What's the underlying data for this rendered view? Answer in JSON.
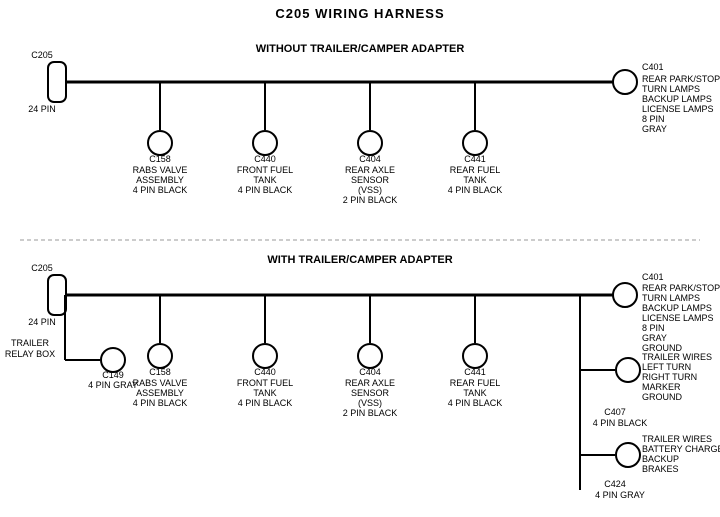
{
  "title": "C205 WIRING HARNESS",
  "section1": {
    "label": "WITHOUT TRAILER/CAMPER ADAPTER",
    "left_connector": {
      "name": "C205",
      "pins": "24 PIN"
    },
    "right_connector": {
      "name": "C401",
      "pins": "8 PIN",
      "color": "GRAY",
      "functions": [
        "REAR PARK/STOP",
        "TURN LAMPS",
        "BACKUP LAMPS",
        "LICENSE LAMPS"
      ]
    },
    "connectors": [
      {
        "name": "C158",
        "desc": "RABS VALVE",
        "desc2": "ASSEMBLY",
        "pins": "4 PIN BLACK"
      },
      {
        "name": "C440",
        "desc": "FRONT FUEL",
        "desc2": "TANK",
        "pins": "4 PIN BLACK"
      },
      {
        "name": "C404",
        "desc": "REAR AXLE",
        "desc2": "SENSOR",
        "desc3": "(VSS)",
        "pins": "2 PIN BLACK"
      },
      {
        "name": "C441",
        "desc": "REAR FUEL",
        "desc2": "TANK",
        "pins": "4 PIN BLACK"
      }
    ]
  },
  "section2": {
    "label": "WITH TRAILER/CAMPER ADAPTER",
    "left_connector": {
      "name": "C205",
      "pins": "24 PIN"
    },
    "right_connector": {
      "name": "C401",
      "pins": "8 PIN",
      "color": "GRAY",
      "functions": [
        "REAR PARK/STOP",
        "TURN LAMPS",
        "BACKUP LAMPS",
        "LICENSE LAMPS",
        "GROUND"
      ]
    },
    "trailer_relay": {
      "label": "TRAILER RELAY BOX"
    },
    "c149": {
      "name": "C149",
      "pins": "4 PIN GRAY"
    },
    "connectors": [
      {
        "name": "C158",
        "desc": "RABS VALVE",
        "desc2": "ASSEMBLY",
        "pins": "4 PIN BLACK"
      },
      {
        "name": "C440",
        "desc": "FRONT FUEL",
        "desc2": "TANK",
        "pins": "4 PIN BLACK"
      },
      {
        "name": "C404",
        "desc": "REAR AXLE",
        "desc2": "SENSOR",
        "desc3": "(VSS)",
        "pins": "2 PIN BLACK"
      },
      {
        "name": "C441",
        "desc": "REAR FUEL",
        "desc2": "TANK",
        "pins": "4 PIN BLACK"
      }
    ],
    "c407": {
      "name": "C407",
      "pins": "4 PIN BLACK",
      "functions": [
        "TRAILER WIRES",
        "LEFT TURN",
        "RIGHT TURN",
        "MARKER",
        "GROUND"
      ]
    },
    "c424": {
      "name": "C424",
      "pins": "4 PIN GRAY",
      "functions": [
        "TRAILER WIRES",
        "BATTERY CHARGE",
        "BACKUP",
        "BRAKES"
      ]
    }
  }
}
